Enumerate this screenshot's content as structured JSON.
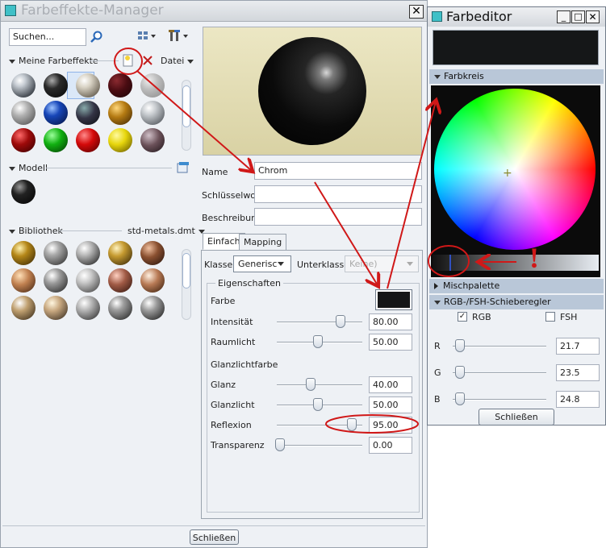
{
  "main": {
    "title": "Farbeffekte-Manager",
    "close": "✕",
    "search_placeholder": "Suchen...",
    "my_effects_label": "Meine Farbeffekte",
    "file_menu": "Datei",
    "model_label": "Modell",
    "library_label": "Bibliothek",
    "library_file": "std-metals.dmt",
    "name_label": "Name",
    "name_value": "Chrom",
    "keyword_label": "Schlüsselwort",
    "keyword_value": "",
    "description_label": "Beschreibung",
    "description_value": "",
    "tabs": [
      "Einfach",
      "Mapping"
    ],
    "class_label": "Klasse",
    "class_value": "Generisc",
    "subclass_label": "Unterklasse",
    "subclass_value": "Keine)",
    "properties_label": "Eigenschaften",
    "color_label": "Farbe",
    "color_swatch": "#151617",
    "properties": [
      {
        "label": "Intensität",
        "value": "80.00",
        "level": 0.8
      },
      {
        "label": "Raumlicht",
        "value": "50.00",
        "level": 0.5
      }
    ],
    "highlight_color_label": "Glanzlichtfarbe",
    "properties2": [
      {
        "label": "Glanz",
        "value": "40.00",
        "level": 0.4
      },
      {
        "label": "Glanzlicht",
        "value": "50.00",
        "level": 0.5
      },
      {
        "label": "Reflexion",
        "value": "95.00",
        "level": 0.95
      },
      {
        "label": "Transparenz",
        "value": "0.00",
        "level": 0.0
      }
    ],
    "close_button": "Schließen"
  },
  "editor": {
    "title": "Farbeditor",
    "color_preview": "#151718",
    "wheel_label": "Farbkreis",
    "mix_label": "Mischpalette",
    "sliders_label": "RGB-/FSH-Schieberegler",
    "rgb_label": "RGB",
    "rgb_checked": true,
    "fsh_label": "FSH",
    "fsh_checked": false,
    "channels": [
      {
        "label": "R",
        "value": "21.7"
      },
      {
        "label": "G",
        "value": "23.5"
      },
      {
        "label": "B",
        "value": "24.8"
      }
    ],
    "close_button": "Schließen"
  },
  "annotation_exclaim": "!",
  "accent_red": "#d01818"
}
